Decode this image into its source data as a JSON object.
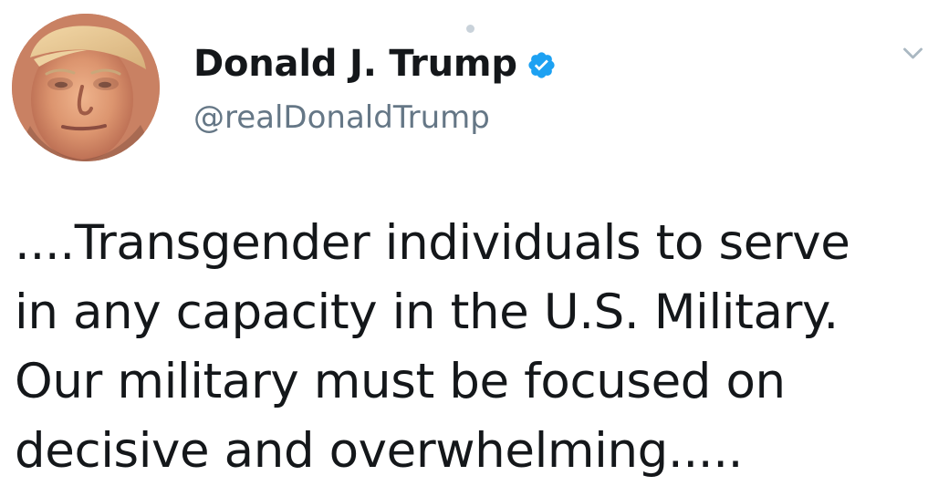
{
  "tweet": {
    "author": {
      "display_name": "Donald J. Trump",
      "handle": "@realDonaldTrump",
      "avatar_icon": "profile-photo",
      "verified_icon": "verified-badge-icon",
      "verified_color": "#1da1f2"
    },
    "menu_icon": "chevron-down-icon",
    "text_lines": [
      "....Transgender individuals to  serve",
      "in any capacity in the U.S. Military.",
      "Our military must be focused on",
      "decisive and overwhelming....."
    ]
  },
  "colors": {
    "background": "#ffffff",
    "text": "#14171a",
    "secondary_text": "#657786",
    "chevron": "#aab8c2",
    "top_dot": "#c9d2da"
  }
}
